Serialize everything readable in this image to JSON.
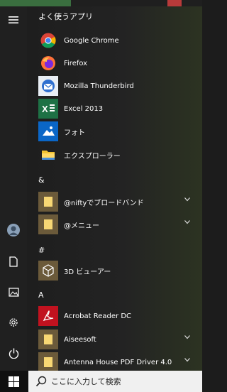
{
  "sections": {
    "frequent": "よく使うアプリ",
    "amp": "&",
    "hash": "#",
    "a": "A"
  },
  "apps": [
    {
      "label": "Google Chrome",
      "icon": "chrome-icon"
    },
    {
      "label": "Firefox",
      "icon": "firefox-icon"
    },
    {
      "label": "Mozilla Thunderbird",
      "icon": "thunderbird-icon"
    },
    {
      "label": "Excel 2013",
      "icon": "excel-icon"
    },
    {
      "label": "フォト",
      "icon": "photos-icon"
    },
    {
      "label": "エクスプローラー",
      "icon": "file-explorer-icon"
    },
    {
      "label": "@niftyでブロードバンド",
      "icon": "folder-icon"
    },
    {
      "label": "@メニュー",
      "icon": "folder-icon"
    },
    {
      "label": "3D ビューアー",
      "icon": "3d-viewer-icon"
    },
    {
      "label": "Acrobat Reader DC",
      "icon": "acrobat-icon"
    },
    {
      "label": "Aiseesoft",
      "icon": "folder-icon"
    },
    {
      "label": "Antenna House PDF Driver 4.0",
      "icon": "folder-icon"
    }
  ],
  "search": {
    "placeholder": "ここに入力して検索"
  },
  "colors": {
    "accent_tile": "#6b5a3a",
    "explorer_tile": "#f1c232"
  }
}
